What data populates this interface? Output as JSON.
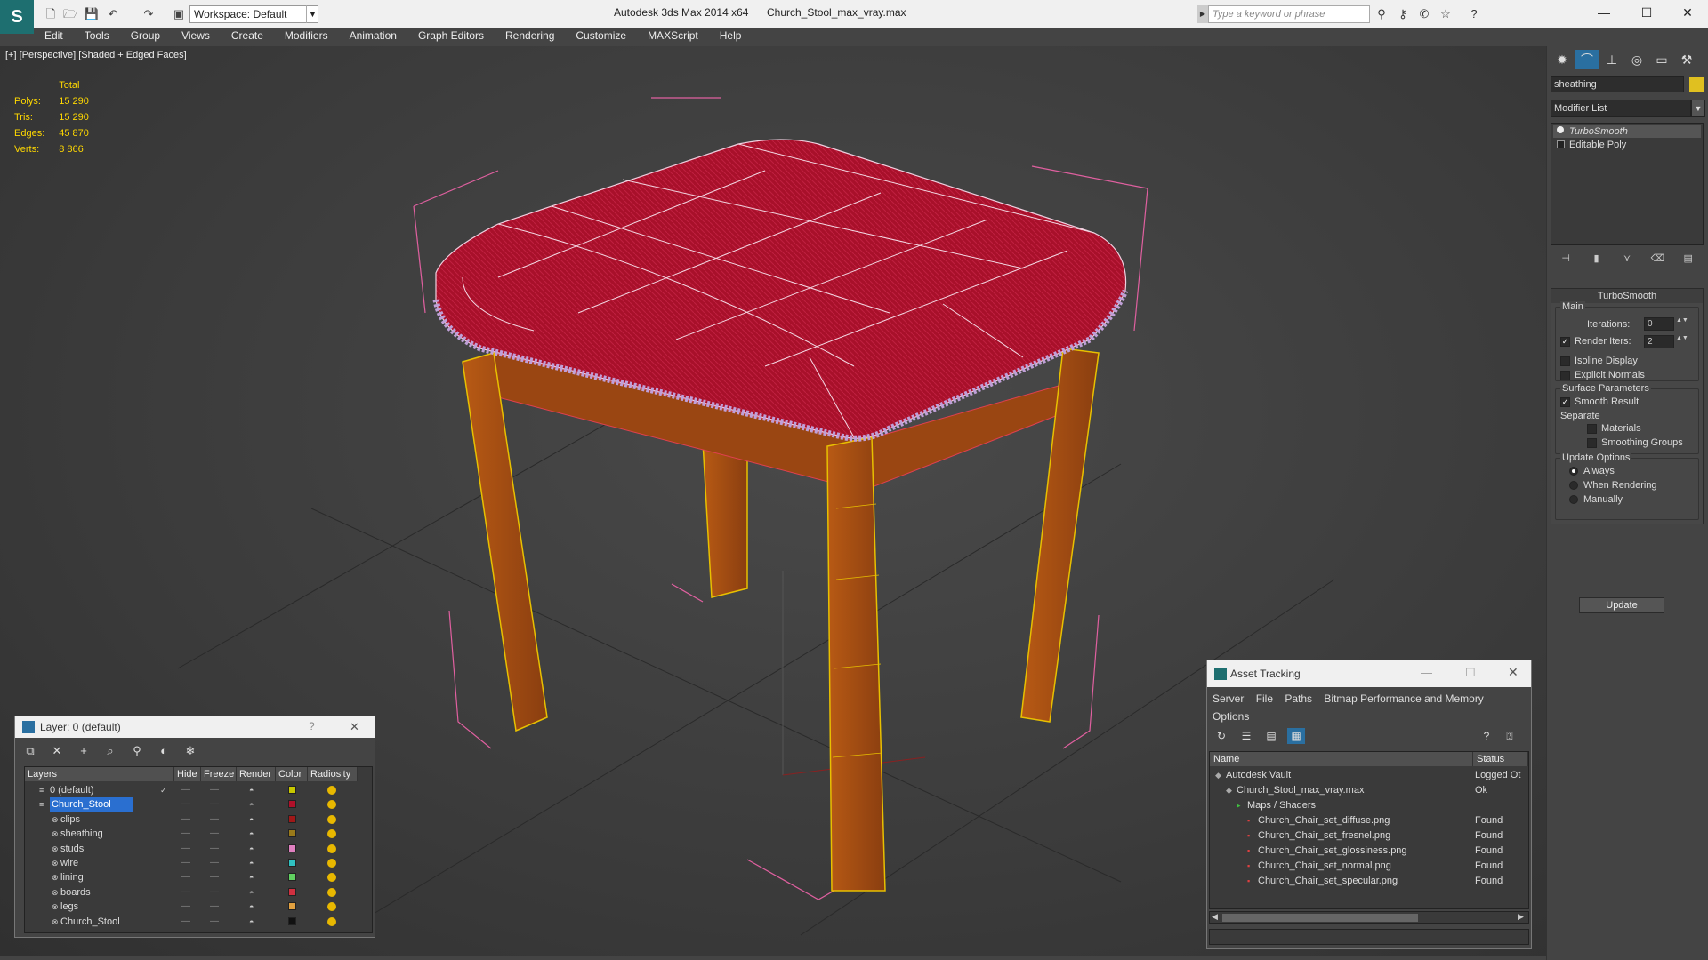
{
  "title_bar": {
    "app_title": "Autodesk 3ds Max  2014 x64",
    "file_title": "Church_Stool_max_vray.max",
    "workspace": "Workspace: Default",
    "search_placeholder": "Type a keyword or phrase",
    "window_controls": [
      "—",
      "☐",
      "✕"
    ]
  },
  "menu": [
    "Edit",
    "Tools",
    "Group",
    "Views",
    "Create",
    "Modifiers",
    "Animation",
    "Graph Editors",
    "Rendering",
    "Customize",
    "MAXScript",
    "Help"
  ],
  "viewport": {
    "label": "[+] [Perspective] [Shaded + Edged Faces]",
    "stats_header": "Total",
    "stats": [
      {
        "label": "Polys:",
        "value": "15 290"
      },
      {
        "label": "Tris:",
        "value": "15 290"
      },
      {
        "label": "Edges:",
        "value": "45 870"
      },
      {
        "label": "Verts:",
        "value": "8 866"
      }
    ]
  },
  "command_panel": {
    "object_name": "sheathing",
    "object_color": "#e0c020",
    "modifier_list": "Modifier List",
    "stack": [
      "TurboSmooth",
      "Editable Poly"
    ],
    "turbosmooth": {
      "title": "TurboSmooth",
      "main": "Main",
      "iterations_label": "Iterations:",
      "iterations": "0",
      "render_iters_label": "Render Iters:",
      "render_iters": "2",
      "isoline": "Isoline Display",
      "explicit_normals": "Explicit Normals",
      "surface_params": "Surface Parameters",
      "smooth_result": "Smooth Result",
      "separate": "Separate",
      "materials": "Materials",
      "smoothing_groups": "Smoothing Groups",
      "update_options": "Update Options",
      "always": "Always",
      "when_rendering": "When Rendering",
      "manually": "Manually",
      "update": "Update"
    }
  },
  "layer_dialog": {
    "title": "Layer: 0 (default)",
    "help": "?",
    "close": "✕",
    "columns": [
      "Layers",
      "Hide",
      "Freeze",
      "Render",
      "Color",
      "Radiosity"
    ],
    "rows": [
      {
        "name": "0 (default)",
        "color": "#c8c800",
        "level": 1
      },
      {
        "name": "Church_Stool",
        "color": "#b0102a",
        "level": 1
      },
      {
        "name": "clips",
        "color": "#a01818",
        "level": 2
      },
      {
        "name": "sheathing",
        "color": "#9a7a1a",
        "level": 2
      },
      {
        "name": "studs",
        "color": "#e080c0",
        "level": 2
      },
      {
        "name": "wire",
        "color": "#30c0c0",
        "level": 2
      },
      {
        "name": "lining",
        "color": "#60d060",
        "level": 2
      },
      {
        "name": "boards",
        "color": "#d03040",
        "level": 2
      },
      {
        "name": "legs",
        "color": "#e0a040",
        "level": 2
      },
      {
        "name": "Church_Stool",
        "color": "#111111",
        "level": 2
      }
    ]
  },
  "asset_tracking": {
    "title": "Asset Tracking",
    "menu": [
      "Server",
      "File",
      "Paths",
      "Bitmap Performance and Memory",
      "Options"
    ],
    "columns": [
      "Name",
      "Status"
    ],
    "rows": [
      {
        "name": "Autodesk Vault",
        "status": "Logged Ot",
        "level": 0
      },
      {
        "name": "Church_Stool_max_vray.max",
        "status": "Ok",
        "level": 1
      },
      {
        "name": "Maps / Shaders",
        "status": "",
        "level": 2
      },
      {
        "name": "Church_Chair_set_diffuse.png",
        "status": "Found",
        "level": 3
      },
      {
        "name": "Church_Chair_set_fresnel.png",
        "status": "Found",
        "level": 3
      },
      {
        "name": "Church_Chair_set_glossiness.png",
        "status": "Found",
        "level": 3
      },
      {
        "name": "Church_Chair_set_normal.png",
        "status": "Found",
        "level": 3
      },
      {
        "name": "Church_Chair_set_specular.png",
        "status": "Found",
        "level": 3
      }
    ]
  }
}
